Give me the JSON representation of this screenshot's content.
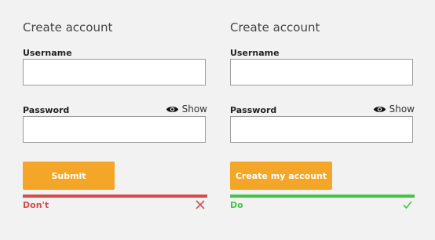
{
  "dont_example": {
    "title": "Create account",
    "username_label": "Username",
    "username_value": "",
    "password_label": "Password",
    "password_value": "",
    "show_label": "Show",
    "button_label": "Submit",
    "verdict_label": "Don't",
    "verdict_icon": "cross-icon",
    "accent_color": "#d44c4c"
  },
  "do_example": {
    "title": "Create account",
    "username_label": "Username",
    "username_value": "",
    "password_label": "Password",
    "password_value": "",
    "show_label": "Show",
    "button_label": "Create my account",
    "verdict_label": "Do",
    "verdict_icon": "check-icon",
    "accent_color": "#47c247"
  },
  "button_color": "#f4a629",
  "eye_icon": "eye-icon"
}
